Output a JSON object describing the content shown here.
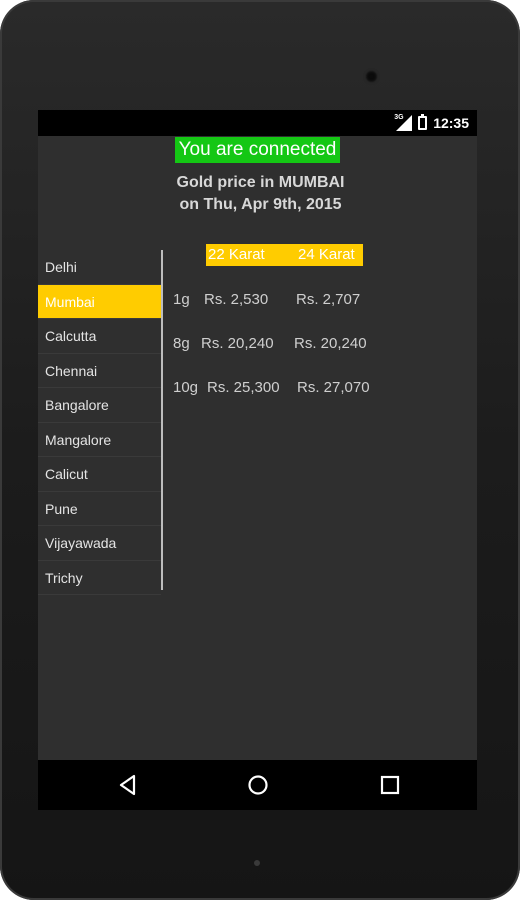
{
  "status_bar": {
    "network": "3G",
    "time": "12:35"
  },
  "connection_status": "You are connected",
  "title": {
    "line1": "Gold price in MUMBAI",
    "line2": "on  Thu, Apr 9th, 2015"
  },
  "cities": [
    {
      "label": "Delhi",
      "selected": false
    },
    {
      "label": "Mumbai",
      "selected": true
    },
    {
      "label": "Calcutta",
      "selected": false
    },
    {
      "label": "Chennai",
      "selected": false
    },
    {
      "label": "Bangalore",
      "selected": false
    },
    {
      "label": "Mangalore",
      "selected": false
    },
    {
      "label": "Calicut",
      "selected": false
    },
    {
      "label": "Pune",
      "selected": false
    },
    {
      "label": "Vijayawada",
      "selected": false
    },
    {
      "label": "Trichy",
      "selected": false
    }
  ],
  "table": {
    "header_22": "22 Karat",
    "header_24": "24 Karat",
    "rows": [
      {
        "weight": "1g",
        "k22": "Rs. 2,530",
        "k24": "Rs. 2,707"
      },
      {
        "weight": "8g",
        "k22": "Rs. 20,240",
        "k24": "Rs. 20,240"
      },
      {
        "weight": "10g",
        "k22": "Rs. 25,300",
        "k24": "Rs. 27,070"
      }
    ]
  },
  "nav": {
    "back_icon": "back-triangle-icon",
    "home_icon": "home-circle-icon",
    "recent_icon": "recent-square-icon"
  },
  "colors": {
    "connected_bg": "#14c714",
    "accent_yellow": "#ffcc00",
    "screen_bg": "#2f2f2f"
  }
}
